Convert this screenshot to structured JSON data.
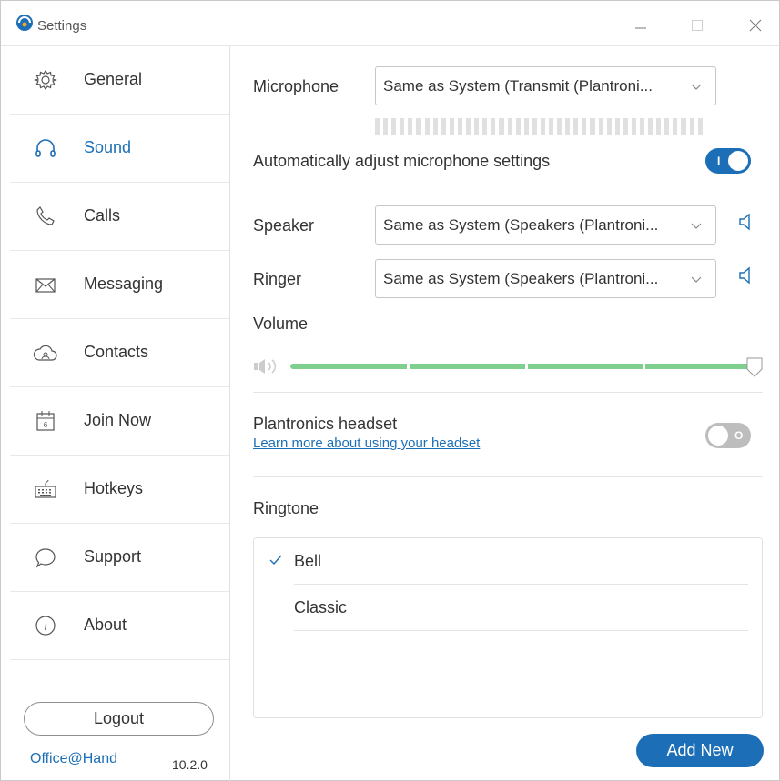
{
  "window": {
    "title": "Settings"
  },
  "sidebar": {
    "items": [
      {
        "label": "General",
        "icon": "gear-icon",
        "active": false
      },
      {
        "label": "Sound",
        "icon": "headphones-icon",
        "active": true
      },
      {
        "label": "Calls",
        "icon": "phone-icon",
        "active": false
      },
      {
        "label": "Messaging",
        "icon": "envelope-icon",
        "active": false
      },
      {
        "label": "Contacts",
        "icon": "contacts-cloud-icon",
        "active": false
      },
      {
        "label": "Join Now",
        "icon": "calendar-icon",
        "active": false
      },
      {
        "label": "Hotkeys",
        "icon": "keyboard-icon",
        "active": false
      },
      {
        "label": "Support",
        "icon": "chat-bubble-icon",
        "active": false
      },
      {
        "label": "About",
        "icon": "info-icon",
        "active": false
      }
    ],
    "calendar_day": "6",
    "logout_label": "Logout",
    "brand": "Office@Hand",
    "version": "10.2.0"
  },
  "sound": {
    "microphone_label": "Microphone",
    "microphone_value": "Same as System (Transmit (Plantroni...",
    "mic_meter_level": 0,
    "auto_adjust_label": "Automatically adjust microphone settings",
    "auto_adjust_on": true,
    "toggle_on_mark": "I",
    "toggle_off_mark": "O",
    "speaker_label": "Speaker",
    "speaker_value": "Same as System (Speakers (Plantroni...",
    "ringer_label": "Ringer",
    "ringer_value": "Same as System (Speakers (Plantroni...",
    "volume_label": "Volume",
    "volume_level": 1.0,
    "headset_label": "Plantronics headset",
    "headset_link": "Learn more about using your headset",
    "headset_on": false,
    "ringtone_label": "Ringtone",
    "ringtones": [
      {
        "label": "Bell",
        "selected": true
      },
      {
        "label": "Classic",
        "selected": false
      }
    ],
    "add_new_label": "Add New"
  },
  "colors": {
    "accent": "#1c6fb6",
    "volume_fill": "#7fcf8f",
    "toggle_off": "#bdbdbd"
  }
}
